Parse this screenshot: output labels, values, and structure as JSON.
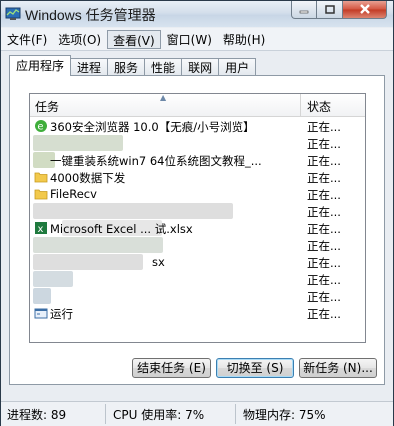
{
  "window": {
    "title": "Windows 任务管理器"
  },
  "menu": [
    {
      "label": "文件(F)"
    },
    {
      "label": "选项(O)"
    },
    {
      "label": "查看(V)"
    },
    {
      "label": "窗口(W)"
    },
    {
      "label": "帮助(H)"
    }
  ],
  "tabs": [
    {
      "label": "应用程序"
    },
    {
      "label": "进程"
    },
    {
      "label": "服务"
    },
    {
      "label": "性能"
    },
    {
      "label": "联网"
    },
    {
      "label": "用户"
    }
  ],
  "list": {
    "headers": {
      "task": "任务",
      "status": "状态"
    },
    "rows": [
      {
        "name": "360安全浏览器 10.0【无痕/小号浏览】",
        "status": "正在...",
        "icon": "browser-icon"
      },
      {
        "name": "",
        "status": "正在...",
        "icon": "app-icon"
      },
      {
        "name": "一键重装系统win7 64位系统图文教程_...",
        "status": "正在...",
        "icon": "app-icon"
      },
      {
        "name": "4000数据下发",
        "status": "正在...",
        "icon": "folder-icon"
      },
      {
        "name": "FileRecv",
        "status": "正在...",
        "icon": "folder-icon"
      },
      {
        "name": "",
        "status": "正在...",
        "icon": "app-icon"
      },
      {
        "name": "Microsoft Excel ... 试.xlsx",
        "status": "正在...",
        "icon": "excel-icon"
      },
      {
        "name": "",
        "status": "正在...",
        "icon": "app-icon"
      },
      {
        "name": "sx",
        "status": "正在...",
        "icon": "app-icon"
      },
      {
        "name": "",
        "status": "正在...",
        "icon": "app-icon"
      },
      {
        "name": "",
        "status": "正在...",
        "icon": "app-icon"
      },
      {
        "name": "运行",
        "status": "正在...",
        "icon": "run-icon"
      }
    ]
  },
  "buttons": {
    "end_task": "结束任务 (E)",
    "switch_to": "切换至 (S)",
    "new_task": "新任务 (N)..."
  },
  "statusbar": {
    "processes": "进程数: 89",
    "cpu": "CPU 使用率: 7%",
    "memory": "物理内存: 75%"
  },
  "colors": {
    "accent": "#3c7fb1",
    "close": "#c23a24"
  }
}
